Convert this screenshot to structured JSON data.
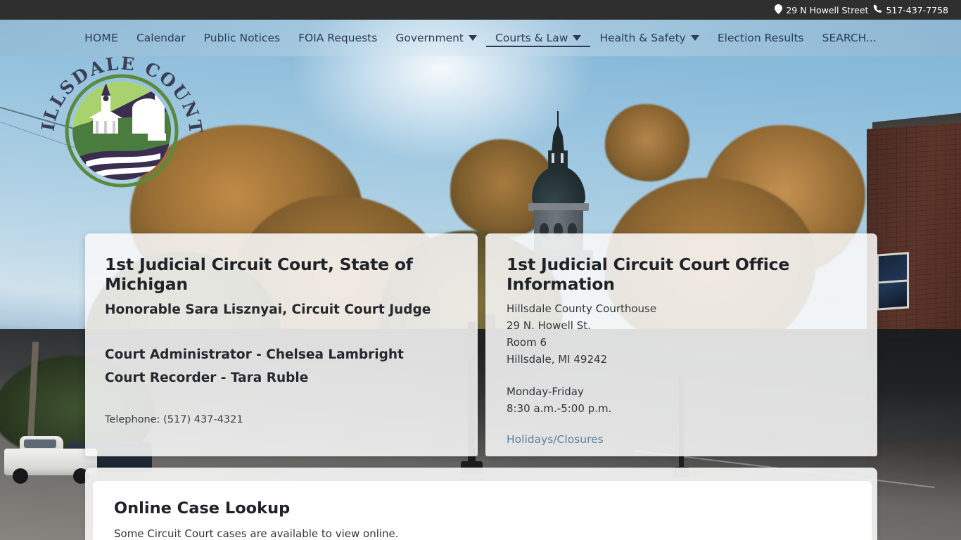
{
  "topbar": {
    "address": "29 N Howell Street",
    "address_icon": "map-pin-icon",
    "phone": "517-437-7758",
    "phone_icon": "phone-icon"
  },
  "logo": {
    "arc_text": "HILLSDALE COUNTY",
    "alt": "Hillsdale County seal",
    "colors": {
      "sky": "#a8d26d",
      "hill_dark": "#3b2d4f",
      "hill_green": "#4a7c3f",
      "ring": "#5c8a3c",
      "water": "#3b2d4f",
      "building": "#ffffff"
    }
  },
  "nav": {
    "items": [
      {
        "label": "HOME",
        "has_caret": false,
        "active": false
      },
      {
        "label": "Calendar",
        "has_caret": false,
        "active": false
      },
      {
        "label": "Public Notices",
        "has_caret": false,
        "active": false
      },
      {
        "label": "FOIA Requests",
        "has_caret": false,
        "active": false
      },
      {
        "label": "Government",
        "has_caret": true,
        "active": false
      },
      {
        "label": "Courts & Law",
        "has_caret": true,
        "active": true
      },
      {
        "label": "Health & Safety",
        "has_caret": true,
        "active": false
      },
      {
        "label": "Election Results",
        "has_caret": false,
        "active": false
      },
      {
        "label": "SEARCH...",
        "has_caret": false,
        "active": false
      }
    ]
  },
  "card_left": {
    "title": "1st Judicial Circuit Court, State of Michigan",
    "subtitle": "Honorable Sara Lisznyai, Circuit Court Judge",
    "administrator": "Court Administrator - Chelsea Lambright",
    "recorder": "Court Recorder - Tara Ruble",
    "telephone": "Telephone: (517) 437-4321"
  },
  "card_right": {
    "title": "1st Judicial Circuit Court Office Information",
    "address_lines": [
      "Hillsdale County Courthouse",
      "29 N. Howell St.",
      "Room 6",
      "Hillsdale, MI 49242"
    ],
    "hours_lines": [
      "Monday-Friday",
      "8:30 a.m.-5:00 p.m."
    ],
    "holidays_link": "Holidays/Closures"
  },
  "bottom_panel": {
    "title": "Online Case Lookup",
    "description": "Some Circuit Court cases are available to view online."
  },
  "colors": {
    "topbar_bg": "#2f2f2f",
    "nav_text": "#2b3d55",
    "heading": "#1f2226",
    "body_text": "#33363a",
    "link": "#5d7f9c",
    "card_bg": "#f8f8f8"
  }
}
